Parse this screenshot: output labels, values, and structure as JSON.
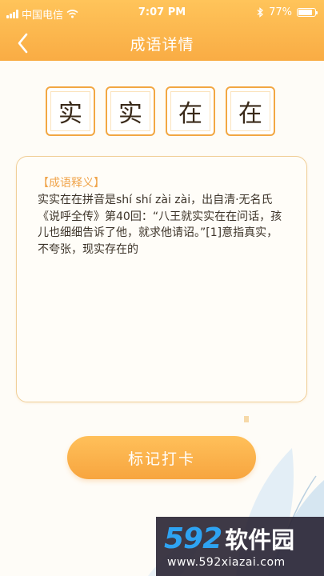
{
  "status_bar": {
    "carrier": "中国电信",
    "time": "7:07 PM",
    "battery": "77%",
    "battery_level": 0.77
  },
  "nav": {
    "title": "成语详情",
    "back_icon": "chevron-left-icon"
  },
  "idiom": {
    "chars": [
      "实",
      "实",
      "在",
      "在"
    ]
  },
  "card": {
    "title": "【成语释义】",
    "text": "实实在在拼音是shí shí zài zài，出自清·无名氏《说呼全传》第40回：“八王就实实在在问话，孩儿也细细告诉了他，就求他请诏。”[1]意指真实，不夸张，现实存在的"
  },
  "checkin_button": {
    "label": "标记打卡"
  },
  "watermark": {
    "number": "592",
    "name": "软件园",
    "url": "www.592xiazai.com"
  },
  "colors": {
    "accent": "#f9ac44",
    "char_border": "#f2a743",
    "card_title": "#f0a44a"
  }
}
